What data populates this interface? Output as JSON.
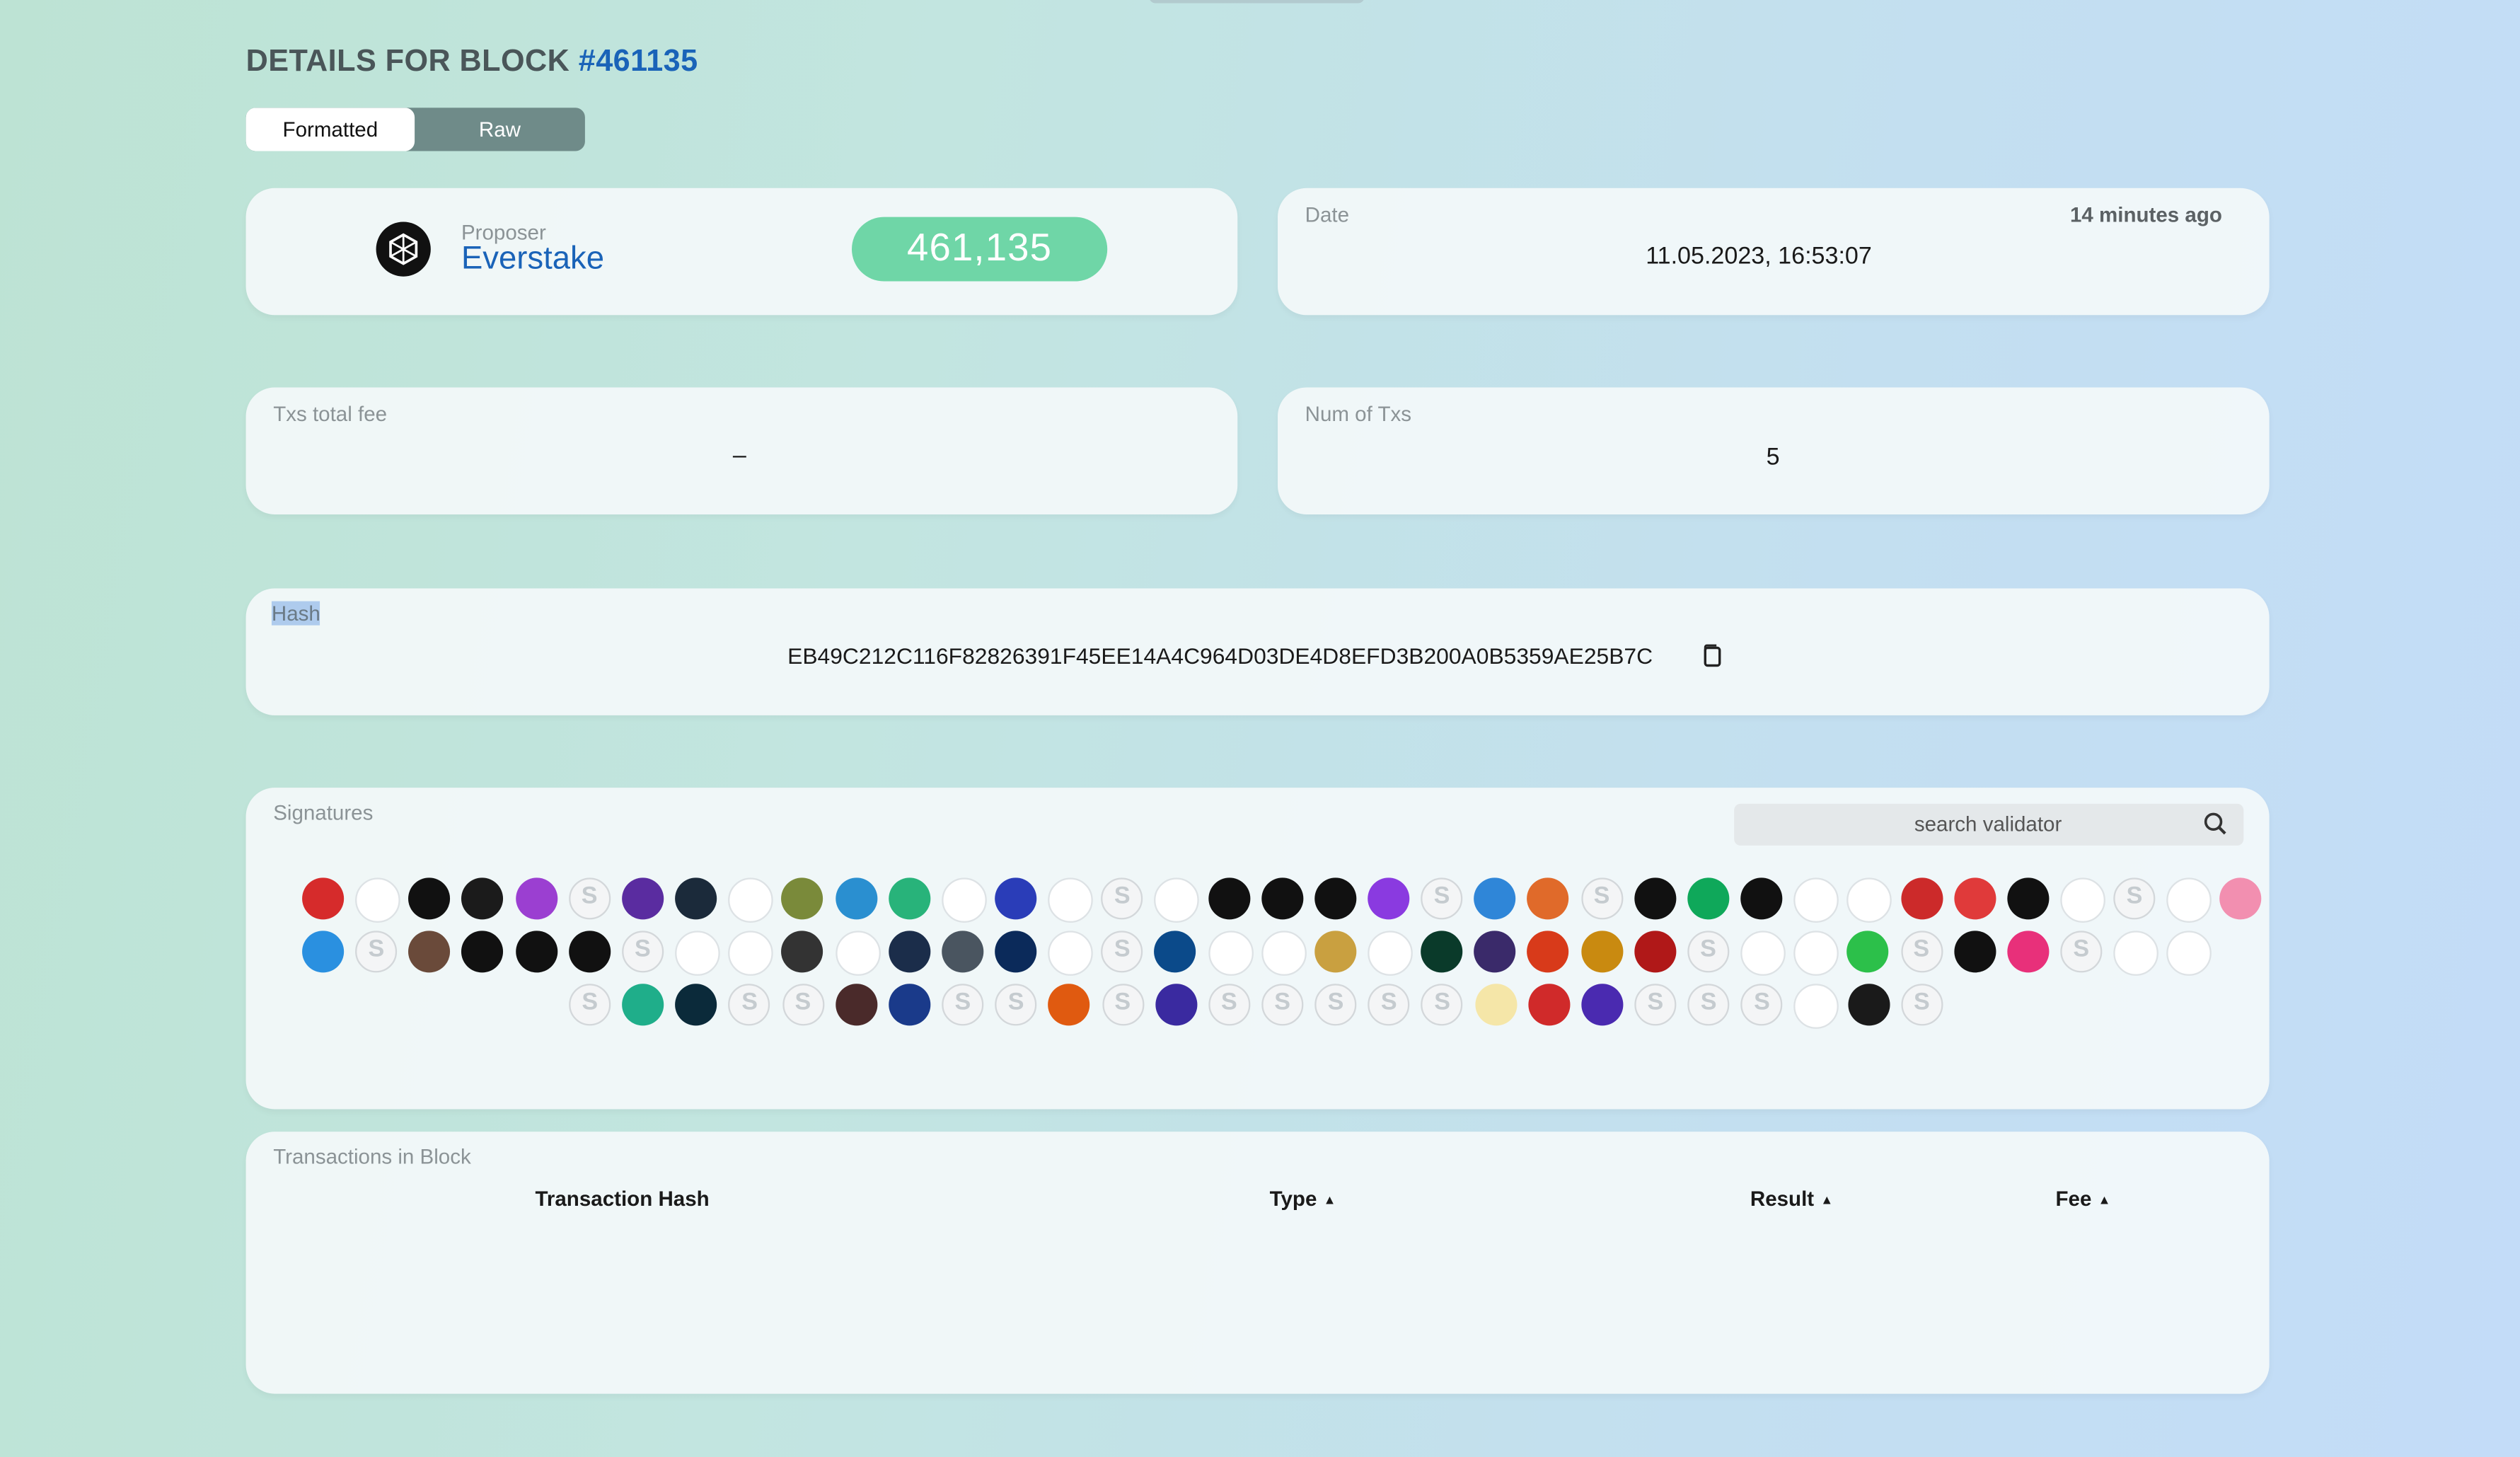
{
  "header": {
    "title_prefix": "DETAILS FOR BLOCK ",
    "block_ref": "#461135"
  },
  "view_toggle": {
    "formatted": "Formatted",
    "raw": "Raw",
    "active": "Formatted"
  },
  "proposer": {
    "label": "Proposer",
    "name": "Everstake",
    "height": "461,135"
  },
  "date": {
    "label": "Date",
    "value": "11.05.2023, 16:53:07",
    "relative": "14 minutes ago"
  },
  "fee": {
    "label": "Txs total fee",
    "value": "–"
  },
  "num_txs": {
    "label": "Num of Txs",
    "value": "5"
  },
  "hash": {
    "label": "Hash",
    "value": "EB49C212C116F82826391F45EE14A4C964D03DE4D8EFD3B200A0B5359AE25B7C"
  },
  "signatures": {
    "label": "Signatures",
    "search_placeholder": "search validator",
    "count": 102
  },
  "transactions": {
    "label": "Transactions in Block",
    "columns": [
      "Transaction Hash",
      "Type",
      "Result",
      "Fee"
    ]
  },
  "colors": {
    "accent": "#1a63b8",
    "height_pill": "#6fd6a7",
    "toggle_off": "#6f8b89"
  }
}
